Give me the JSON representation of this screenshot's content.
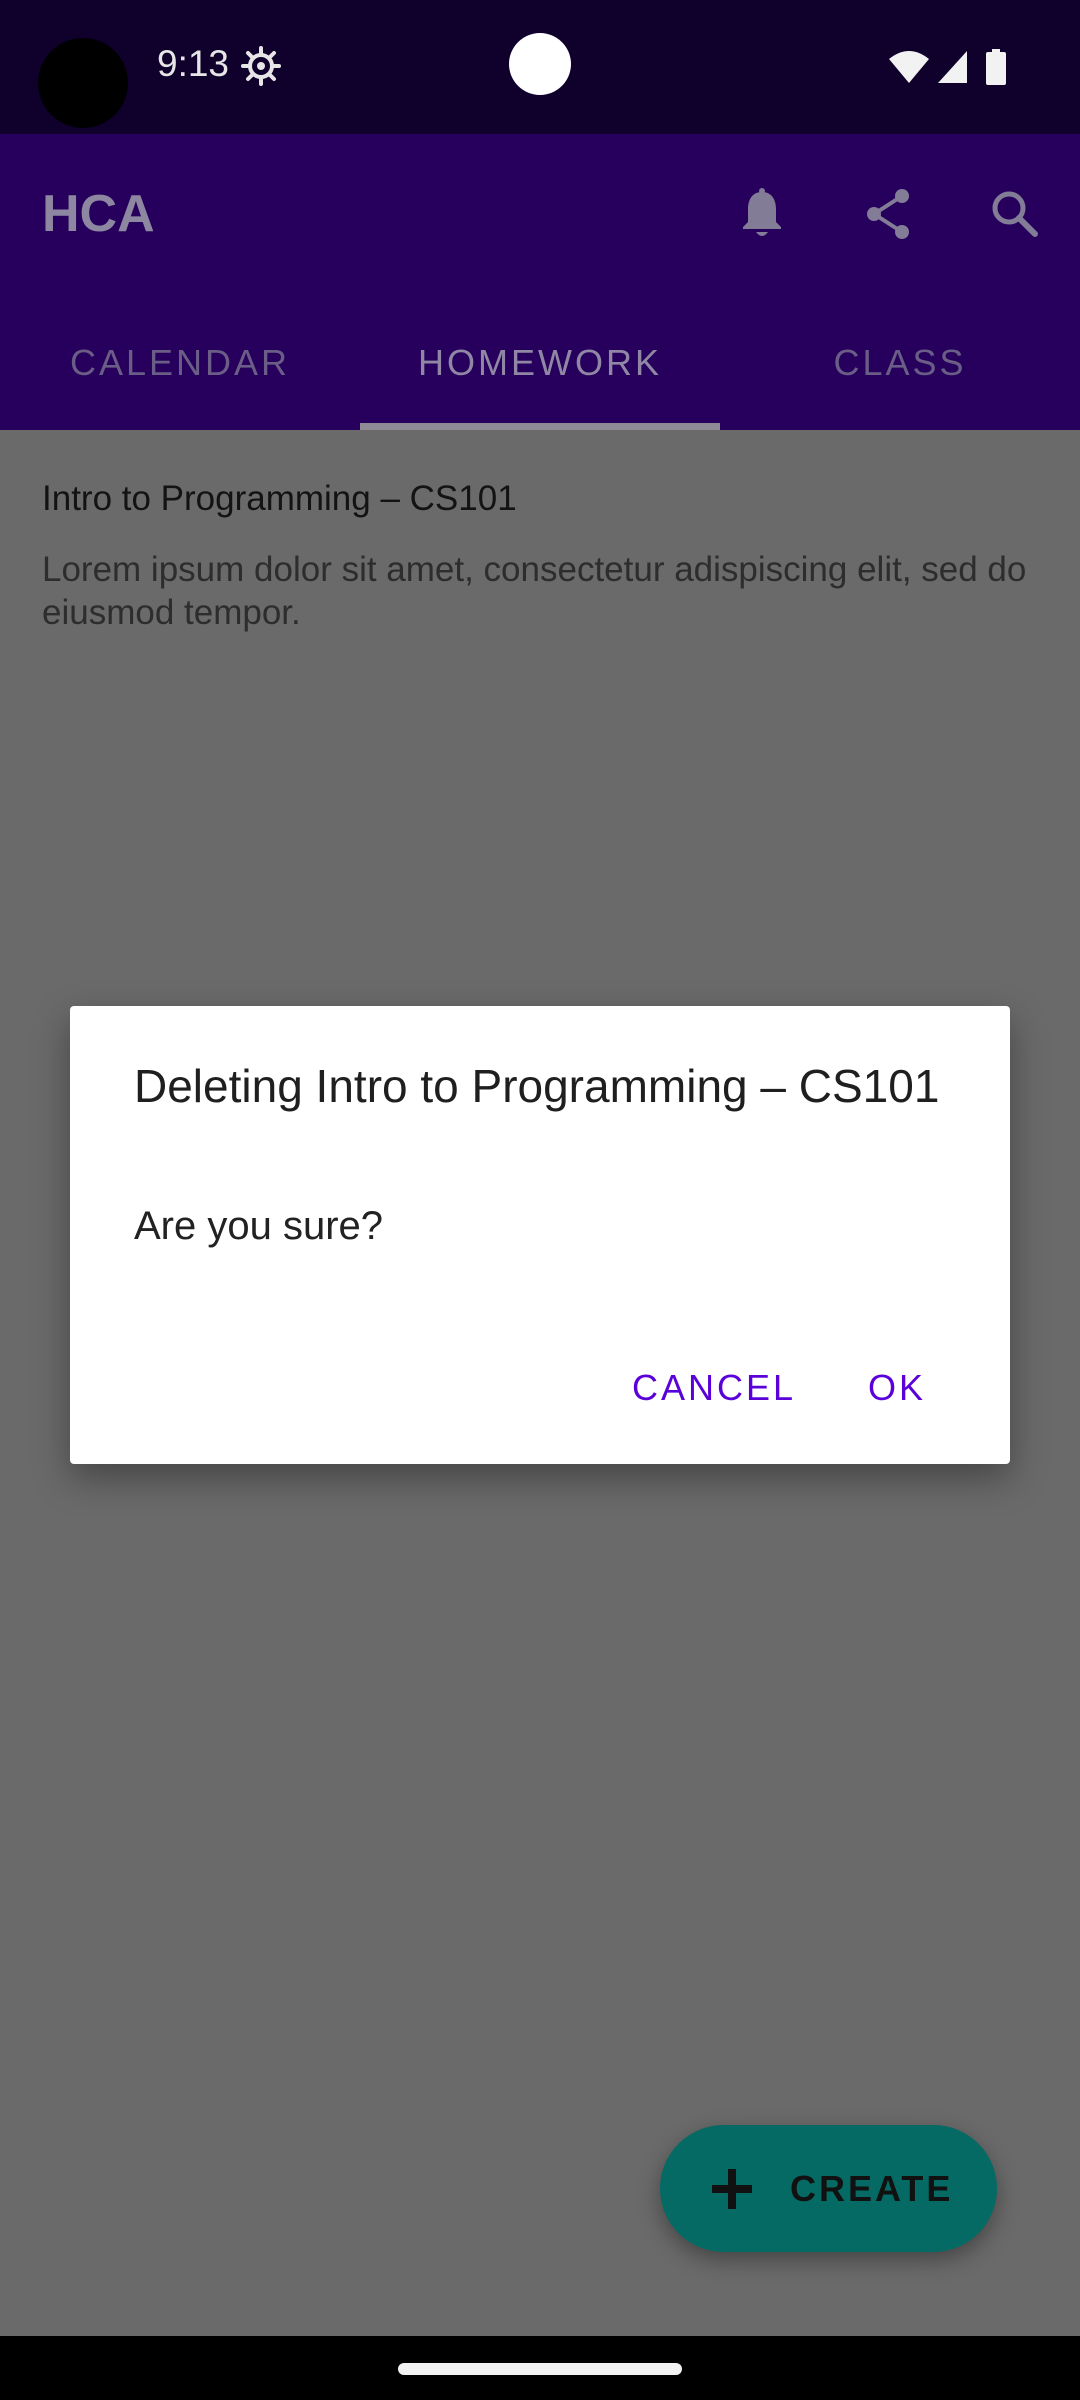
{
  "status_bar": {
    "time": "9:13"
  },
  "app_bar": {
    "title": "HCA",
    "tabs": [
      {
        "label": "CALENDAR"
      },
      {
        "label": "HOMEWORK"
      },
      {
        "label": "CLASS"
      }
    ],
    "selected_tab": "HOMEWORK"
  },
  "homework_item": {
    "title": "Intro to Programming – CS101",
    "description": "Lorem ipsum dolor sit amet, consectetur adispiscing elit, sed do eiusmod tempor."
  },
  "dialog": {
    "title": "Deleting Intro to Programming – CS101",
    "message": "Are you sure?",
    "cancel_label": "CANCEL",
    "ok_label": "OK"
  },
  "fab": {
    "label": "CREATE"
  },
  "icons": {
    "status": [
      "settings-icon",
      "wifi-icon",
      "signal-icon",
      "battery-icon"
    ],
    "app_bar": [
      "bell-icon",
      "share-icon",
      "search-icon"
    ],
    "fab": "plus-icon"
  },
  "colors": {
    "status_bar": "#0f002c",
    "app_bar": "#26005c",
    "scrim_background": "#6a6a6a",
    "dialog_button": "#5a00d8",
    "fab": "#046a63"
  }
}
